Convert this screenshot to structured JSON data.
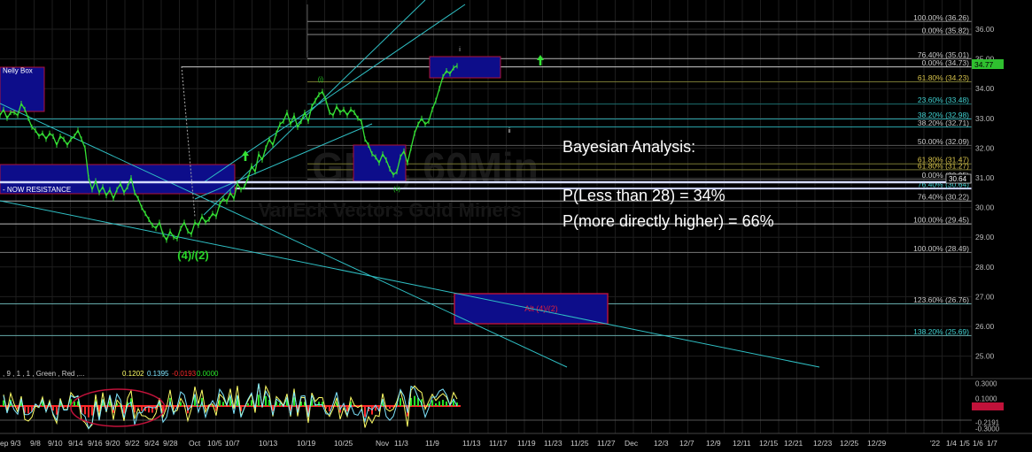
{
  "chart_data": {
    "type": "line",
    "title": "",
    "price_axis": {
      "labels": [
        "36.00",
        "35.00",
        "34.00",
        "33.00",
        "32.00",
        "31.00",
        "30.00",
        "29.00",
        "28.00",
        "27.00",
        "26.00",
        "25.00"
      ],
      "values": [
        36,
        35,
        34,
        33,
        32,
        31,
        30,
        29,
        28,
        27,
        26,
        25
      ],
      "current_price": "34.77",
      "secondary_marker": "30.64"
    },
    "date_axis": [
      "ep 9/3",
      "9/8",
      "9/10",
      "9/14",
      "9/16",
      "9/20",
      "9/22",
      "9/24",
      "9/28",
      "Oct",
      "10/5",
      "10/7",
      "10/13",
      "10/19",
      "10/25",
      "Nov",
      "11/3",
      "11/9",
      "11/13",
      "11/17",
      "11/19",
      "11/23",
      "11/25",
      "11/27",
      "Dec",
      "12/3",
      "12/7",
      "12/9",
      "12/11",
      "12/15",
      "12/21",
      "12/23",
      "12/25",
      "12/29",
      "'22",
      "1/4",
      "1/5",
      "1/6",
      "1/7"
    ],
    "fib_levels": [
      {
        "label": "100.00% (36.26)",
        "value": 36.26
      },
      {
        "label": "0.00% (35.82)",
        "value": 35.82
      },
      {
        "label": "76.40% (35.01)",
        "value": 35.01
      },
      {
        "label": "0.00% (34.73)",
        "value": 34.73
      },
      {
        "label": "61.80% (34.23)",
        "value": 34.23
      },
      {
        "label": "23.60% (33.48)",
        "value": 33.48
      },
      {
        "label": "38.20% (32.98)",
        "value": 32.98
      },
      {
        "label": "38.20% (32.71)",
        "value": 32.71
      },
      {
        "label": "50.00% (32.09)",
        "value": 32.09
      },
      {
        "label": "61.80% (31.47)",
        "value": 31.47
      },
      {
        "label": "61.80% (31.27)",
        "value": 31.27
      },
      {
        "label": "0.00% (30.95)",
        "value": 30.95
      },
      {
        "label": "76.40% (30.64)",
        "value": 30.64
      },
      {
        "label": "76.40% (30.22)",
        "value": 30.22
      },
      {
        "label": "100.00% (29.45)",
        "value": 29.45
      },
      {
        "label": "100.00% (28.49)",
        "value": 28.49
      },
      {
        "label": "123.60% (26.76)",
        "value": 26.76
      },
      {
        "label": "138.20% (25.69)",
        "value": 25.69
      }
    ],
    "wave_labels": [
      "(4)/(2)",
      "(i)",
      "(ii)",
      "i",
      "ii"
    ],
    "boxes": [
      {
        "label": "Nelly Box"
      },
      {
        "label": "- NOW RESISTANCE"
      },
      {
        "label": "Alt (4)/(2)"
      }
    ],
    "price_series": [
      [
        0,
        33.1
      ],
      [
        4,
        33.3
      ],
      [
        8,
        33.0
      ],
      [
        12,
        33.2
      ],
      [
        16,
        33.2
      ],
      [
        20,
        33.1
      ],
      [
        24,
        33.5
      ],
      [
        28,
        33.3
      ],
      [
        32,
        33.0
      ],
      [
        36,
        32.7
      ],
      [
        40,
        32.6
      ],
      [
        44,
        32.4
      ],
      [
        48,
        32.5
      ],
      [
        52,
        32.3
      ],
      [
        56,
        32.5
      ],
      [
        60,
        32.4
      ],
      [
        64,
        32.1
      ],
      [
        68,
        32.4
      ],
      [
        72,
        32.3
      ],
      [
        76,
        32.1
      ],
      [
        80,
        32.3
      ],
      [
        84,
        32.4
      ],
      [
        88,
        32.6
      ],
      [
        92,
        32.3
      ],
      [
        96,
        32.0
      ],
      [
        100,
        31.0
      ],
      [
        104,
        30.6
      ],
      [
        108,
        30.9
      ],
      [
        112,
        30.5
      ],
      [
        116,
        30.7
      ],
      [
        120,
        30.4
      ],
      [
        124,
        30.6
      ],
      [
        128,
        30.3
      ],
      [
        132,
        30.6
      ],
      [
        136,
        30.8
      ],
      [
        140,
        30.5
      ],
      [
        144,
        30.7
      ],
      [
        148,
        31.0
      ],
      [
        152,
        30.5
      ],
      [
        156,
        30.3
      ],
      [
        160,
        30.0
      ],
      [
        164,
        29.8
      ],
      [
        168,
        29.6
      ],
      [
        172,
        29.4
      ],
      [
        176,
        29.3
      ],
      [
        180,
        29.5
      ],
      [
        184,
        29.1
      ],
      [
        188,
        28.9
      ],
      [
        192,
        29.2
      ],
      [
        196,
        29.0
      ],
      [
        200,
        28.95
      ],
      [
        204,
        29.3
      ],
      [
        208,
        29.5
      ],
      [
        212,
        29.2
      ],
      [
        216,
        29.1
      ],
      [
        220,
        29.5
      ],
      [
        224,
        29.4
      ],
      [
        228,
        29.7
      ],
      [
        232,
        29.5
      ],
      [
        236,
        29.6
      ],
      [
        240,
        29.8
      ],
      [
        244,
        29.7
      ],
      [
        248,
        30.1
      ],
      [
        252,
        30.3
      ],
      [
        256,
        30.2
      ],
      [
        260,
        30.5
      ],
      [
        264,
        30.3
      ],
      [
        268,
        30.8
      ],
      [
        272,
        30.6
      ],
      [
        276,
        30.7
      ],
      [
        280,
        31.0
      ],
      [
        284,
        31.4
      ],
      [
        288,
        31.2
      ],
      [
        292,
        31.8
      ],
      [
        296,
        31.6
      ],
      [
        300,
        32.0
      ],
      [
        304,
        32.3
      ],
      [
        308,
        32.1
      ],
      [
        312,
        32.5
      ],
      [
        316,
        32.8
      ],
      [
        320,
        32.9
      ],
      [
        324,
        33.2
      ],
      [
        328,
        32.8
      ],
      [
        332,
        33.1
      ],
      [
        336,
        32.7
      ],
      [
        340,
        32.9
      ],
      [
        344,
        33.2
      ],
      [
        348,
        32.9
      ],
      [
        352,
        33.4
      ],
      [
        356,
        33.6
      ],
      [
        360,
        33.8
      ],
      [
        364,
        33.9
      ],
      [
        368,
        33.6
      ],
      [
        372,
        33.2
      ],
      [
        376,
        33.1
      ],
      [
        380,
        33.4
      ],
      [
        384,
        33.2
      ],
      [
        388,
        33.3
      ],
      [
        392,
        33.1
      ],
      [
        396,
        33.3
      ],
      [
        400,
        33.2
      ],
      [
        404,
        33.0
      ],
      [
        408,
        32.9
      ],
      [
        412,
        32.3
      ],
      [
        416,
        32.1
      ],
      [
        420,
        31.8
      ],
      [
        424,
        31.7
      ],
      [
        428,
        31.5
      ],
      [
        432,
        31.8
      ],
      [
        436,
        31.6
      ],
      [
        440,
        31.3
      ],
      [
        444,
        31.1
      ],
      [
        448,
        31.2
      ],
      [
        452,
        31.7
      ],
      [
        456,
        31.9
      ],
      [
        460,
        31.5
      ],
      [
        464,
        32.0
      ],
      [
        468,
        32.5
      ],
      [
        472,
        32.8
      ],
      [
        476,
        33.0
      ],
      [
        480,
        32.8
      ],
      [
        484,
        32.9
      ],
      [
        488,
        33.3
      ],
      [
        492,
        33.6
      ],
      [
        496,
        34.0
      ],
      [
        500,
        34.4
      ],
      [
        504,
        34.6
      ],
      [
        508,
        34.5
      ],
      [
        512,
        34.7
      ],
      [
        516,
        34.77
      ]
    ],
    "oscillator": {
      "header": ", 9 , 1 , 1 , Green , Red ,...",
      "values": [
        "0.1202",
        "0.1395",
        "-0.0193",
        "0.0000"
      ],
      "axis_labels": [
        "0.3000",
        "0.1000",
        "-0.0193",
        "-0.2191",
        "-0.3000"
      ]
    },
    "grid": true
  },
  "analysis": {
    "heading": "Bayesian Analysis:",
    "line1": "P(Less than 28) = 34%",
    "line2": "P(more directly higher) = 66%"
  },
  "watermark": "GDX, 60Min — VanEck Vectors Gold Miners",
  "colors": {
    "background": "#000000",
    "price": "#35e235",
    "channel": "#2fbfc4",
    "box_fill": "#0d0d8a",
    "box_border_red": "#b0123a",
    "fib_label": "#c8c8c8",
    "wave_label": "#28d728",
    "alt_label": "#e0203a",
    "osc_yellow": "#ffff66",
    "osc_cyan": "#7fe6ff",
    "osc_red": "#ff2a2a",
    "osc_green": "#27e027"
  }
}
